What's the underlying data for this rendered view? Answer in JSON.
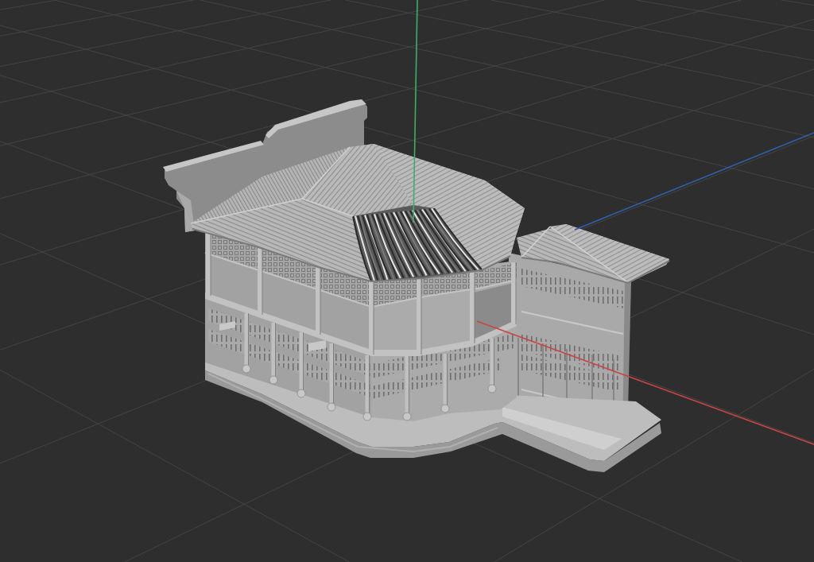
{
  "viewport": {
    "axes": [
      {
        "kind": "x",
        "color": "#c94444"
      },
      {
        "kind": "y",
        "color": "#3cae6c"
      },
      {
        "kind": "z",
        "color": "#2f5faa"
      }
    ]
  }
}
